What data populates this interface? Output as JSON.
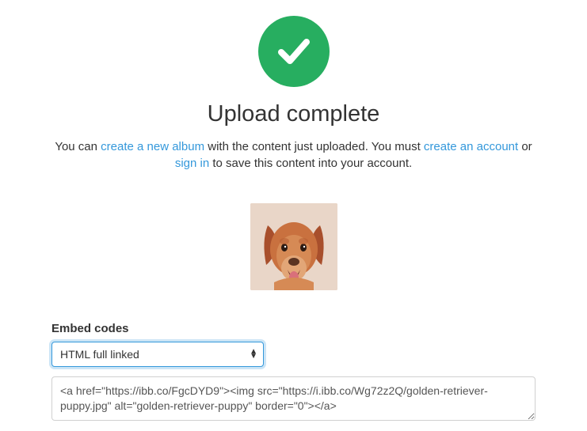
{
  "heading": "Upload complete",
  "subtitle": {
    "prefix": "You can ",
    "link_create_album": "create a new album",
    "mid1": " with the content just uploaded. You must ",
    "link_create_account": "create an account",
    "mid2": " or ",
    "link_sign_in": "sign in",
    "suffix": " to save this content into your account."
  },
  "thumbnail_alt": "golden-retriever-puppy",
  "embed": {
    "label": "Embed codes",
    "selected": "HTML full linked",
    "code": "<a href=\"https://ibb.co/FgcDYD9\"><img src=\"https://i.ibb.co/Wg72z2Q/golden-retriever-puppy.jpg\" alt=\"golden-retriever-puppy\" border=\"0\"></a>"
  },
  "colors": {
    "accent": "#27ae60",
    "link": "#3498db"
  }
}
